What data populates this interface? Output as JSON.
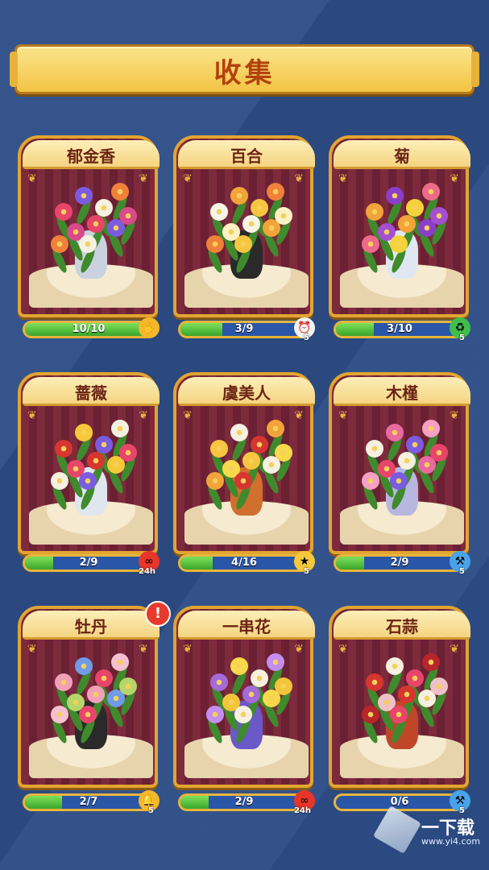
{
  "header": {
    "title": "收集"
  },
  "cards": [
    {
      "name": "郁金香",
      "progress": "10/10",
      "fraction": 1.0,
      "badge": "tap-gesture-icon",
      "badge_count": ""
    },
    {
      "name": "百合",
      "progress": "3/9",
      "fraction": 0.33,
      "badge": "timer-clock-icon",
      "badge_count": "5"
    },
    {
      "name": "菊",
      "progress": "3/10",
      "fraction": 0.3,
      "badge": "refresh-arrows-icon",
      "badge_count": "5"
    },
    {
      "name": "蔷薇",
      "progress": "2/9",
      "fraction": 0.22,
      "badge": "infinity-heart-icon",
      "badge_count": "24h"
    },
    {
      "name": "虞美人",
      "progress": "4/16",
      "fraction": 0.25,
      "badge": "star-wand-icon",
      "badge_count": "5"
    },
    {
      "name": "木槿",
      "progress": "2/9",
      "fraction": 0.22,
      "badge": "hammer-icon",
      "badge_count": "5"
    },
    {
      "name": "牡丹",
      "progress": "2/7",
      "fraction": 0.29,
      "badge": "bell-icon",
      "badge_count": "5",
      "alert": "!"
    },
    {
      "name": "一串花",
      "progress": "2/9",
      "fraction": 0.22,
      "badge": "infinity-heart-icon",
      "badge_count": "24h"
    },
    {
      "name": "石蒜",
      "progress": "0/6",
      "fraction": 0.0,
      "badge": "hammer-icon",
      "badge_count": "5"
    }
  ],
  "watermark": {
    "title": "一下载",
    "url": "www.yi4.com"
  },
  "colors": {
    "background": "#2d4d86",
    "gold": "#e2a532",
    "title_red": "#b3420d",
    "progress_green": "#3aa52a",
    "bar_blue": "#2a56a8"
  }
}
